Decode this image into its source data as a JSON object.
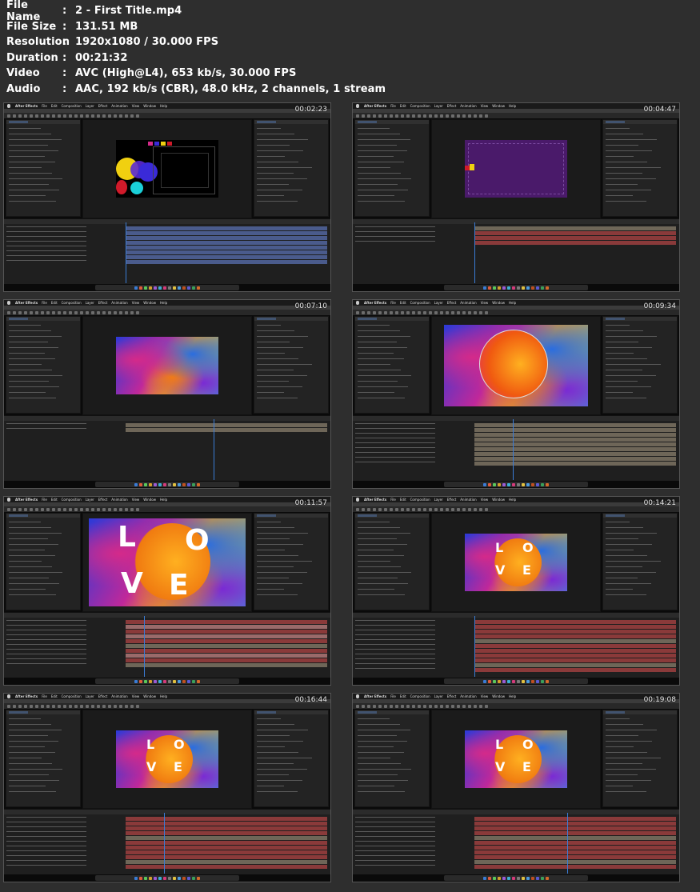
{
  "file_info": [
    {
      "key": "File Name",
      "value": "2 - First Title.mp4"
    },
    {
      "key": "File Size",
      "value": "131.51 MB"
    },
    {
      "key": "Resolution",
      "value": "1920x1080 / 30.000 FPS"
    },
    {
      "key": "Duration",
      "value": "00:21:32"
    },
    {
      "key": "Video",
      "value": "AVC (High@L4), 653 kb/s, 30.000 FPS"
    },
    {
      "key": "Audio",
      "value": "AAC, 192 kb/s (CBR), 48.0 kHz, 2 channels, 1 stream"
    }
  ],
  "colon": ":",
  "app": {
    "name": "After Effects",
    "menu": [
      "File",
      "Edit",
      "Composition",
      "Layer",
      "Effect",
      "Animation",
      "View",
      "Window",
      "Help"
    ]
  },
  "thumbnails": [
    {
      "timestamp": "00:02:23",
      "scene": "shapes"
    },
    {
      "timestamp": "00:04:47",
      "scene": "purple"
    },
    {
      "timestamp": "00:07:10",
      "scene": "gradient"
    },
    {
      "timestamp": "00:09:34",
      "scene": "circle"
    },
    {
      "timestamp": "00:11:57",
      "scene": "love-large"
    },
    {
      "timestamp": "00:14:21",
      "scene": "love-small"
    },
    {
      "timestamp": "00:16:44",
      "scene": "love-small"
    },
    {
      "timestamp": "00:19:08",
      "scene": "love-small"
    }
  ],
  "love_letters": [
    "L",
    "O",
    "V",
    "E"
  ],
  "colors": {
    "timeline_bar_blue": "#4a5b8c",
    "timeline_bar_red": "#8a3a3a",
    "timeline_bar_tan": "#6e6658",
    "timeline_bar_pink": "#9a6a6a",
    "cursor": "#3a7bd5"
  }
}
